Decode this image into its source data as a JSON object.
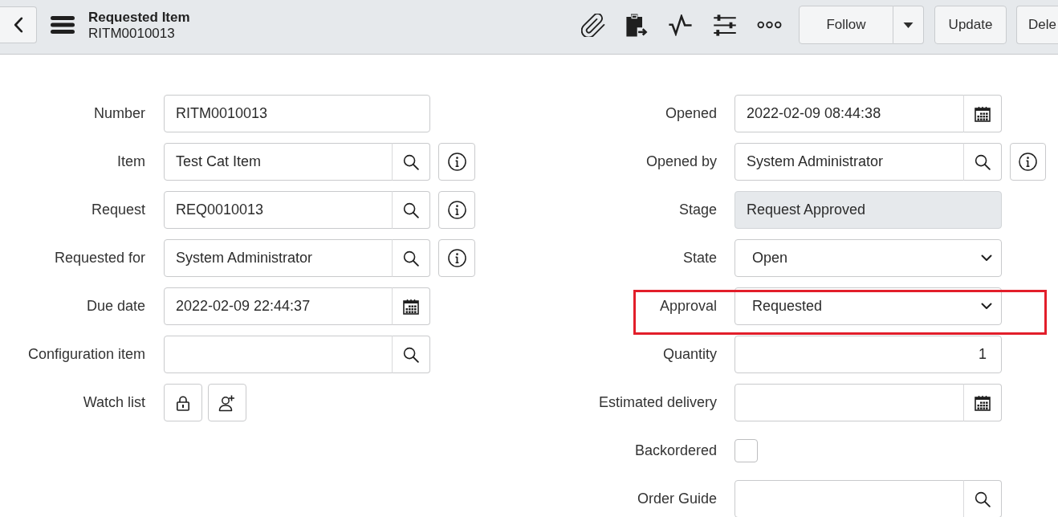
{
  "header": {
    "title": "Requested Item",
    "subtitle": "RITM0010013"
  },
  "actions": [
    {
      "label": "Follow",
      "kind": "split"
    },
    {
      "label": "Update",
      "kind": "plain"
    },
    {
      "label": "Dele",
      "kind": "plain"
    }
  ],
  "form": {
    "left": [
      {
        "label": "Number",
        "kind": "text",
        "value": "RITM0010013",
        "info": false,
        "highlighted": false
      },
      {
        "label": "Item",
        "kind": "lookup",
        "value": "Test Cat Item",
        "info": true,
        "highlighted": false
      },
      {
        "label": "Request",
        "kind": "lookup",
        "value": "REQ0010013",
        "info": true,
        "highlighted": false
      },
      {
        "label": "Requested for",
        "kind": "lookup",
        "value": "System Administrator",
        "info": true,
        "highlighted": false
      },
      {
        "label": "Due date",
        "kind": "date",
        "value": "2022-02-09 22:44:37",
        "info": false,
        "highlighted": false
      },
      {
        "label": "Configuration item",
        "kind": "lookup",
        "info": false,
        "highlighted": false
      },
      {
        "label": "Watch list",
        "kind": "watchlist",
        "info": false,
        "highlighted": false
      }
    ],
    "right": [
      {
        "label": "Opened",
        "kind": "date",
        "value": "2022-02-09 08:44:38",
        "info": false,
        "highlighted": false
      },
      {
        "label": "Opened by",
        "kind": "lookup",
        "value": "System Administrator",
        "info": true,
        "highlighted": false
      },
      {
        "label": "Stage",
        "kind": "readonly",
        "value": "Request Approved",
        "info": false,
        "highlighted": false
      },
      {
        "label": "State",
        "kind": "choice",
        "value": "Open",
        "info": false,
        "highlighted": false
      },
      {
        "label": "Approval",
        "kind": "choice",
        "value": "Requested",
        "info": false,
        "highlighted": true
      },
      {
        "label": "Quantity",
        "kind": "number",
        "value": "1",
        "info": false,
        "highlighted": false
      },
      {
        "label": "Estimated delivery",
        "kind": "date",
        "info": false,
        "highlighted": false
      },
      {
        "label": "Backordered",
        "kind": "checkbox",
        "checked": false,
        "info": false,
        "highlighted": false
      },
      {
        "label": "Order Guide",
        "kind": "lookup",
        "info": false,
        "highlighted": false
      }
    ]
  }
}
